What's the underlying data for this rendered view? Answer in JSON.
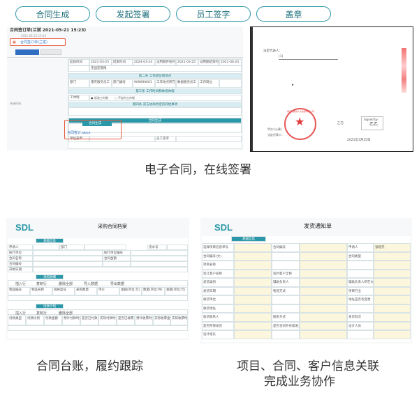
{
  "steps": [
    {
      "label": "合同生成"
    },
    {
      "label": "发起签署"
    },
    {
      "label": "员工签字"
    },
    {
      "label": "盖章"
    }
  ],
  "contract_panel": {
    "title": "合同签订单(兰斌 2021-05-21 15:23)",
    "sub": "2021-05-21 15:23",
    "file1": "合同签订单(兰斌)",
    "rows": [
      {
        "c1": "起始时间",
        "c2": "2021-03-25",
        "c3": "结束时间",
        "c4": "2024-03-24",
        "c5": "试用期开始时间",
        "c6": "2021-03-25",
        "c7": "试用期结束时间",
        "c8": "2021-06-24"
      },
      {
        "c1": "",
        "c2": "无固定期限",
        "c3": "",
        "c4": "",
        "c5": "",
        "c6": "",
        "c7": "",
        "c8": ""
      }
    ],
    "section2": "第二条 工作岗位和地点",
    "dept_row": {
      "a": "部门",
      "b": "重庆服务员工",
      "c": "部门编号",
      "d": "909090601",
      "e": "工作地点所在城市",
      "f": "数据服务员工",
      "g": "工作岗位",
      "h": ""
    },
    "section3": "第三条 工作时间和休息休假",
    "work_label": "工时制",
    "work_opt1": "标准工时制",
    "work_opt2": "不定时工作制",
    "section4": "第四条 双方协商约定的其他事项",
    "gen_title": "合同生成",
    "gen_file": "合同签订.docx",
    "bottom1": "单位盖章",
    "bottom2": "员工签字"
  },
  "seal_panel": {
    "line1": "法定代表人:",
    "line2": "(1)",
    "seal_text": "重庆市某某人力资源有限公司",
    "signed": "Signed by:",
    "party_b": "乙方:",
    "date": "2021年3月25日",
    "party_a": "甲方:(公章)",
    "rep": "法定代表人:"
  },
  "caption1": "电子合同，在线签署",
  "archive_panel": {
    "logo": "SDL",
    "title": "采购合同档案",
    "sec1": "基础信息",
    "fields": [
      "申请人",
      "部门",
      "流水号",
      "执行单位",
      "执行单位编号",
      "合同名称",
      "合同金额",
      "合同编号",
      "开始日期"
    ],
    "sec2": "采购明细",
    "toolbar": [
      "插入行",
      "复制行",
      "删除全部",
      "导入数据",
      "导出数据"
    ],
    "cols": [
      "物品编号",
      "物品名称",
      "规格型号",
      "采购数量",
      "单价",
      "金额(单位:元)",
      "数量(单位:件)",
      "金额(单位:元)"
    ],
    "sec3": "付款计划",
    "pay_cols": [
      "付款类型",
      "付款比例",
      "付款金额",
      "预计付款时间",
      "是否已付款",
      "实际付款时间",
      "是否已收票",
      "预计收票时间",
      "实际收票金额",
      "实际收票时间"
    ]
  },
  "notice_panel": {
    "logo": "SDL",
    "title": "发货通知单",
    "sec1": "基础信息",
    "rows": [
      [
        "选择项目信息单号",
        "",
        "合同编号",
        "",
        "申请人",
        "张晓杰"
      ],
      [
        "合同编号(文)",
        "",
        "",
        "",
        "合同类型",
        ""
      ],
      [
        "项目名称",
        "",
        "",
        "",
        "",
        ""
      ],
      [
        "签订客户名称",
        "",
        "签约客户全称",
        "",
        "",
        ""
      ],
      [
        "发货类别",
        "",
        "辅助负责人",
        "",
        "辅助负责人所在大区或事业部",
        ""
      ],
      [
        "发货日期",
        "",
        "物流方式",
        "",
        "项目行业",
        ""
      ],
      [
        "收货单位",
        "",
        "",
        "",
        "地址是否有变更",
        ""
      ],
      [
        "收货地址",
        "",
        "",
        "",
        "",
        ""
      ],
      [
        "收货联系人",
        "",
        "联系方式",
        "",
        "发货批次",
        ""
      ],
      [
        "是否所保发货",
        "",
        "是否合同外有偿发货",
        "",
        "设计人员",
        ""
      ],
      [
        "设计组长",
        "",
        "",
        "",
        "",
        ""
      ]
    ]
  },
  "caption2": "合同台账，履约跟踪",
  "caption3_line1": "项目、合同、客户信息关联",
  "caption3_line2": "完成业务协作"
}
